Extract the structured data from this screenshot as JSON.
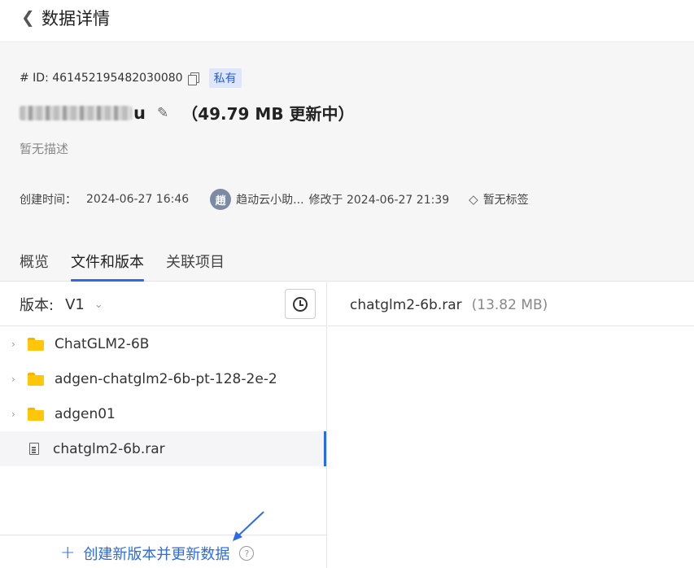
{
  "header": {
    "back_icon": "chevron-left-icon",
    "title": "数据详情"
  },
  "dataset": {
    "id_text": "# ID: 461452195482030080",
    "visibility_badge": "私有",
    "name_visible_tail": "u",
    "size_status": "（49.79 MB 更新中）",
    "description": "暂无描述",
    "created_label": "创建时间：",
    "created_time": "2024-06-27 16:46",
    "avatar_char": "趙",
    "modified_by": "趋动云小助...",
    "modified_text": "修改于 2024-06-27 21:39",
    "tags_text": "暂无标签"
  },
  "tabs": [
    {
      "label": "概览",
      "active": false
    },
    {
      "label": "文件和版本",
      "active": true
    },
    {
      "label": "关联项目",
      "active": false
    }
  ],
  "version": {
    "label": "版本:",
    "value": "V1"
  },
  "tree": [
    {
      "type": "folder",
      "label": "ChatGLM2-6B"
    },
    {
      "type": "folder",
      "label": "adgen-chatglm2-6b-pt-128-2e-2"
    },
    {
      "type": "folder",
      "label": "adgen01"
    },
    {
      "type": "file",
      "label": "chatglm2-6b.rar",
      "selected": true
    }
  ],
  "bottom": {
    "create_label": "创建新版本并更新数据",
    "help_glyph": "?"
  },
  "detail": {
    "file_name": "chatglm2-6b.rar",
    "file_size": "(13.82 MB)"
  },
  "colors": {
    "accent": "#2b6be6",
    "folder": "#ffc60a",
    "badge_bg": "#dde6fa"
  }
}
